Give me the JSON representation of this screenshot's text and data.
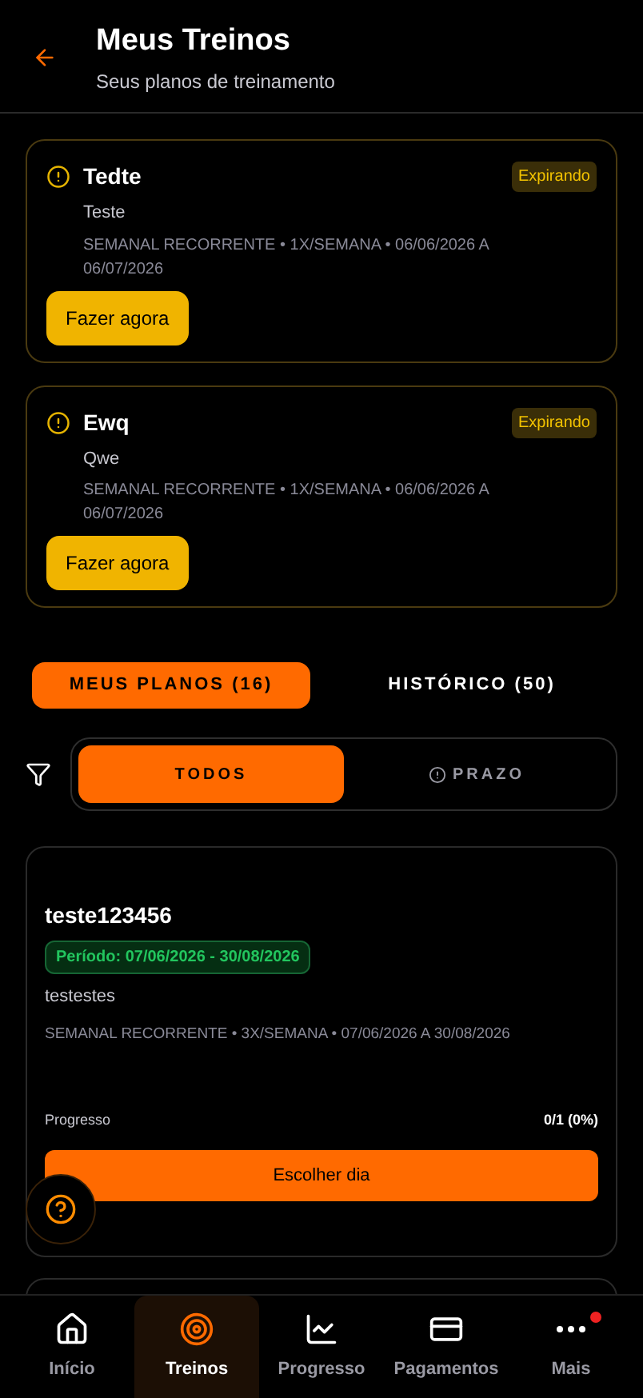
{
  "header": {
    "title": "Meus Treinos",
    "subtitle": "Seus planos de treinamento"
  },
  "alerts": [
    {
      "title": "Tedte",
      "badge": "Expirando",
      "description": "Teste",
      "meta": "SEMANAL RECORRENTE • 1X/SEMANA • 06/06/2026 A 06/07/2026",
      "button": "Fazer agora"
    },
    {
      "title": "Ewq",
      "badge": "Expirando",
      "description": "Qwe",
      "meta": "SEMANAL RECORRENTE • 1X/SEMANA • 06/06/2026 A 06/07/2026",
      "button": "Fazer agora"
    }
  ],
  "tabs": [
    {
      "label": "MEUS PLANOS (16)",
      "selected": true
    },
    {
      "label": "HISTÓRICO (50)",
      "selected": false
    }
  ],
  "filters": [
    {
      "label": "TODOS",
      "selected": true
    },
    {
      "label": "PRAZO",
      "selected": false
    }
  ],
  "plans": [
    {
      "title": "teste123456",
      "period": "Período: 07/06/2026 - 30/08/2026",
      "description": "testestes",
      "meta": "SEMANAL RECORRENTE • 3X/SEMANA • 07/06/2026 A 30/08/2026",
      "progress_label": "Progresso",
      "progress_value": "0/1 (0%)",
      "button": "Escolher dia"
    }
  ],
  "nav": [
    {
      "label": "Início",
      "selected": false,
      "badge": false
    },
    {
      "label": "Treinos",
      "selected": true,
      "badge": false
    },
    {
      "label": "Progresso",
      "selected": false,
      "badge": false
    },
    {
      "label": "Pagamentos",
      "selected": false,
      "badge": false
    },
    {
      "label": "Mais",
      "selected": false,
      "badge": true
    }
  ]
}
